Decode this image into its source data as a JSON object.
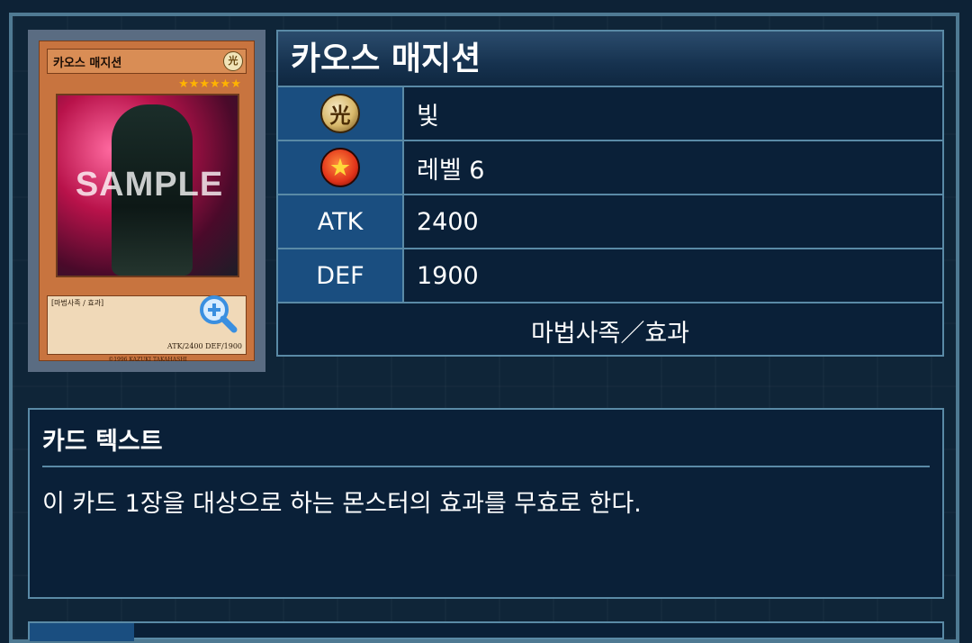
{
  "card": {
    "name": "카오스 매지션",
    "image": {
      "card_name": "카오스 매지션",
      "attribute_glyph": "光",
      "stars": "★★★★★★",
      "watermark": "SAMPLE",
      "type_line": "[마법사족 / 효과]",
      "stats_line": "ATK/2400  DEF/1900",
      "copyright": "©1996 KAZUKI TAKAHASHI"
    },
    "attribute": {
      "icon": "light-attribute-icon",
      "glyph": "光",
      "value": "빛"
    },
    "level": {
      "icon": "level-star-icon",
      "glyph": "★",
      "value": "레벨 6"
    },
    "atk": {
      "label": "ATK",
      "value": "2400"
    },
    "def": {
      "label": "DEF",
      "value": "1900"
    },
    "type": "마법사족／효과"
  },
  "card_text": {
    "title": "카드 텍스트",
    "body": "이 카드 1장을 대상으로 하는 몬스터의 효과를 무효로 한다."
  },
  "colors": {
    "background": "#0f2538",
    "border": "#5a8aa6",
    "label_cell": "#1a4e80",
    "value_cell": "#0a2038"
  }
}
